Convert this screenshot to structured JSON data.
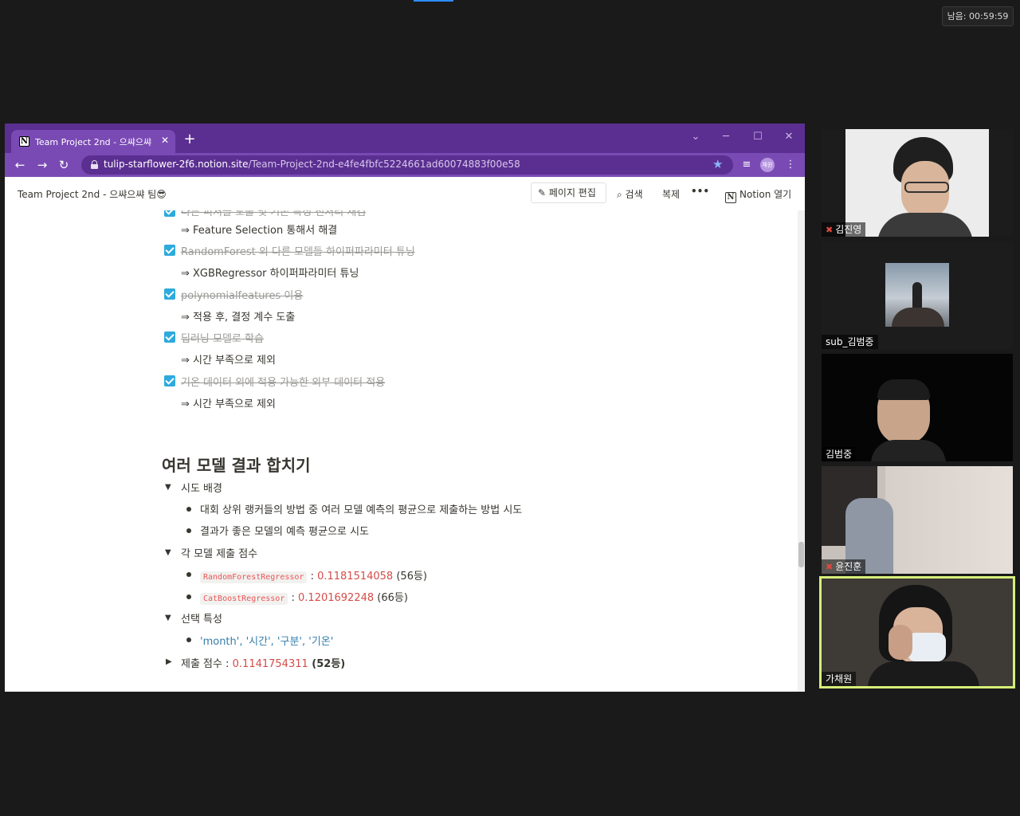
{
  "meeting": {
    "timer": "남음: 00:59:59"
  },
  "browser": {
    "tab_title": "Team Project 2nd - 으쌰으쌰 팀",
    "tab_close": "✕",
    "new_tab": "+",
    "url_host": "tulip-starflower-2f6.notion.site",
    "url_path": "/Team-Project-2nd-e4fe4fbfc5224661ad60074883f00e58",
    "profile_label": "채원"
  },
  "notion_header": {
    "breadcrumb": "Team Project 2nd - 으쌰으쌰 팀😎",
    "edit_label": "페이지 편집",
    "search_label": "검색",
    "duplicate_label": "복제",
    "more_label": "•••",
    "open_label": "Notion 열기"
  },
  "content": {
    "todos": [
      {
        "text": "다른 피처들 도출 및 기존 특성 전처리 재검",
        "done": true,
        "note": "⇒ Feature Selection 통해서 해결"
      },
      {
        "text": "RandomForest 외 다른 모델들 하이퍼파라미터 튜닝",
        "done": true,
        "note": "⇒ XGBRegressor 하이퍼파라미터 튜닝"
      },
      {
        "text": "polynomialfeatures 이용",
        "done": true,
        "note": "⇒ 적용 후, 결정 계수 도출"
      },
      {
        "text": "딥러닝 모델로 학습",
        "done": true,
        "note": "⇒ 시간 부족으로 제외"
      },
      {
        "text": "기온 데이터 외에 적용 가능한 외부 데이터 적용",
        "done": true,
        "note": "⇒ 시간 부족으로 제외"
      }
    ],
    "section_title": "여러 모델 결과 합치기",
    "toggle_background": {
      "label": "시도 배경",
      "items": [
        "대회 상위 랭커들의 방법 중 여러 모델 예측의 평균으로 제출하는 방법 시도",
        "결과가 좋은 모델의 예측 평균으로 시도"
      ]
    },
    "toggle_scores": {
      "label": "각 모델 제출 점수",
      "items": [
        {
          "model": "RandomForestRegressor",
          "sep": " : ",
          "score": "0.1181514058",
          "rank": " (56등)"
        },
        {
          "model": "CatBoostRegressor",
          "sep": " : ",
          "score": "0.1201692248",
          "rank": " (66등)"
        }
      ]
    },
    "toggle_features": {
      "label": "선택 특성",
      "items": [
        "'month', '시간', '구분', '기온'"
      ]
    },
    "toggle_final": {
      "label": "제출 점수",
      "sep": " : ",
      "score": "0.1141754311",
      "rank": " (52등)"
    }
  },
  "participants": [
    {
      "name": "김진영",
      "muted": true
    },
    {
      "name": "sub_김범중",
      "muted": false
    },
    {
      "name": "김범중",
      "muted": false
    },
    {
      "name": "윤진훈",
      "muted": true
    },
    {
      "name": "가채원",
      "muted": false,
      "speaking": true
    }
  ],
  "icons": {
    "back": "arrow-left-icon",
    "forward": "arrow-right-icon",
    "reload": "reload-icon",
    "lock": "lock-icon",
    "star": "star-icon",
    "mic_muted": "mic-muted-icon"
  }
}
